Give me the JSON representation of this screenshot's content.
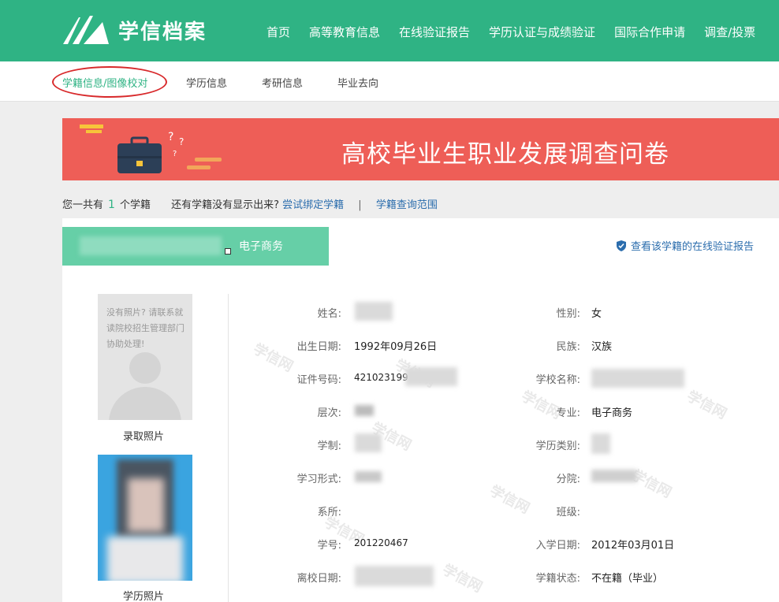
{
  "header": {
    "logo_text": "学信档案",
    "nav": [
      "首页",
      "高等教育信息",
      "在线验证报告",
      "学历认证与成绩验证",
      "国际合作申请",
      "调查/投票"
    ]
  },
  "subnav": [
    "学籍信息/图像校对",
    "学历信息",
    "考研信息",
    "毕业去向"
  ],
  "banner": {
    "title": "高校毕业生职业发展调查问卷"
  },
  "summary": {
    "prefix": "您一共有",
    "count": "1",
    "suffix": "个学籍",
    "question": "还有学籍没有显示出来?",
    "bind_link": "尝试绑定学籍",
    "separator": "|",
    "range_link": "学籍查询范围"
  },
  "record": {
    "major_tab": "电子商务",
    "verify_link": "查看该学籍的在线验证报告",
    "no_photo_text": "没有照片? 请联系就读院校招生管理部门协助处理!",
    "photo1_label": "录取照片",
    "photo2_label": "学历照片",
    "watermark": "学信网",
    "fields": {
      "name_label": "姓名:",
      "gender_label": "性别:",
      "gender": "女",
      "birth_label": "出生日期:",
      "birth": "1992年09月26日",
      "ethnic_label": "民族:",
      "ethnic": "汉族",
      "id_label": "证件号码:",
      "id": "421023199",
      "school_label": "学校名称:",
      "level_label": "层次:",
      "major_label": "专业:",
      "major": "电子商务",
      "duration_label": "学制:",
      "category_label": "学历类别:",
      "form_label": "学习形式:",
      "branch_label": "分院:",
      "dept_label": "系所:",
      "class_label": "班级:",
      "sid_label": "学号:",
      "sid": "201220467",
      "enroll_label": "入学日期:",
      "enroll": "2012年03月01日",
      "leave_label": "离校日期:",
      "status_label": "学籍状态:",
      "status": "不在籍（毕业）"
    }
  },
  "colors": {
    "brand": "#2fb384",
    "banner": "#ee5e57",
    "link": "#2b6dad",
    "highlight_circle": "#d8292b"
  }
}
